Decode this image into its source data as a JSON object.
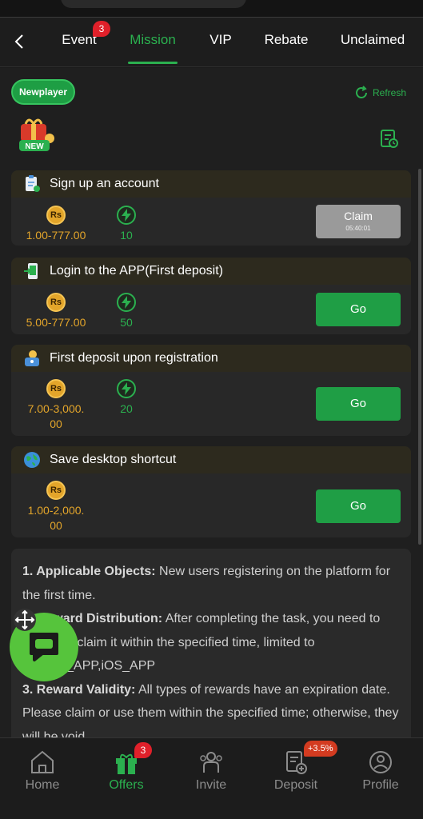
{
  "tabs": [
    {
      "label": "Event",
      "badge": "3",
      "active": false
    },
    {
      "label": "Mission",
      "active": true
    },
    {
      "label": "VIP",
      "active": false
    },
    {
      "label": "Rebate",
      "active": false
    },
    {
      "label": "Unclaimed",
      "active": false
    }
  ],
  "header": {
    "newplayer_label": "Newplayer",
    "refresh_label": "Refresh",
    "new_label": "NEW"
  },
  "tasks": [
    {
      "title": "Sign up an account",
      "coin_symbol": "Rs",
      "coin_reward_lines": [
        "1.00-777.00"
      ],
      "energy_reward": "10",
      "button_label": "Claim",
      "button_timer": "05:40:01",
      "button_state": "disabled"
    },
    {
      "title": "Login to the APP(First deposit)",
      "coin_symbol": "Rs",
      "coin_reward_lines": [
        "5.00-777.00"
      ],
      "energy_reward": "50",
      "button_label": "Go"
    },
    {
      "title": "First deposit upon registration",
      "coin_symbol": "Rs",
      "coin_reward_lines": [
        "7.00-3,000.",
        "00"
      ],
      "energy_reward": "20",
      "button_label": "Go"
    },
    {
      "title": "Save desktop shortcut",
      "coin_symbol": "Rs",
      "coin_reward_lines": [
        "1.00-2,000.",
        "00"
      ],
      "button_label": "Go"
    }
  ],
  "rules": [
    {
      "heading": "1. Applicable Objects:",
      "text": " New users registering on the platform for the first time."
    },
    {
      "heading": "2. Reward Distribution:",
      "text": " After completing the task, you need to manually claim it within the specified time, limited to Android_APP,iOS_APP"
    },
    {
      "heading": "3. Reward Validity:",
      "text": " All types of rewards have an expiration date. Please claim or use them within the specified time; otherwise, they will be void."
    }
  ],
  "bottom_nav": [
    {
      "label": "Home",
      "active": false
    },
    {
      "label": "Offers",
      "active": true,
      "badge": "3"
    },
    {
      "label": "Invite",
      "active": false
    },
    {
      "label": "Deposit",
      "active": false,
      "badge": "+3.5%"
    },
    {
      "label": "Profile",
      "active": false
    }
  ],
  "colors": {
    "accent_green": "#2bb04f",
    "gold": "#e3a52a",
    "badge_red": "#e0202a",
    "chat_green": "#56c43c"
  }
}
